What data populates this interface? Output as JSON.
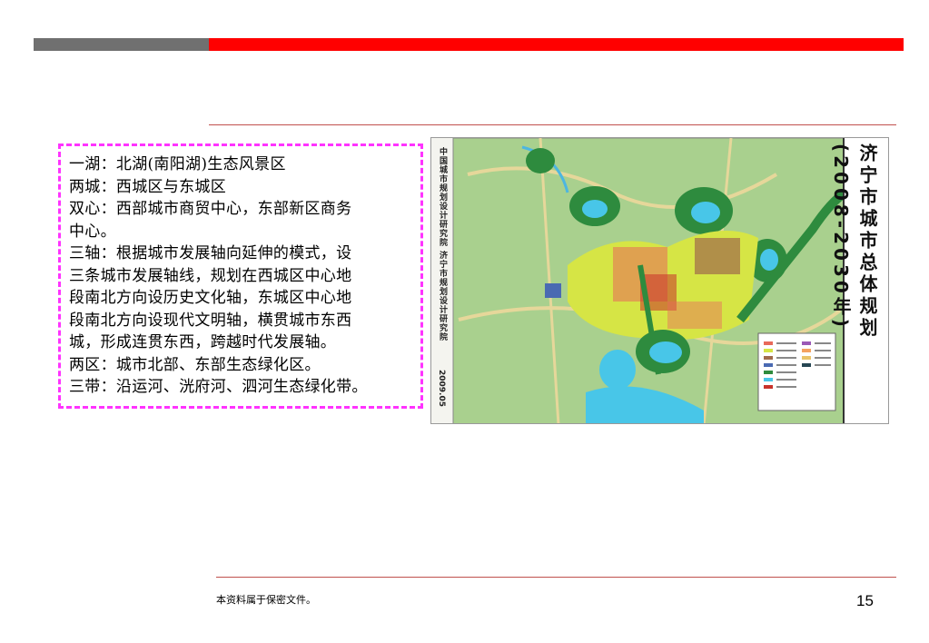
{
  "colors": {
    "accent": "#ff0000",
    "gray_bar": "#707070",
    "rule": "#c0504d",
    "dashed_border": "#ff33ff"
  },
  "content": {
    "lines": [
      "一湖：北湖(南阳湖)生态风景区",
      "两城：西城区与东城区",
      "双心：西部城市商贸中心，东部新区商务",
      "中心。",
      "三轴：根据城市发展轴向延伸的模式，设",
      "三条城市发展轴线，规划在西城区中心地",
      "段南北方向设历史文化轴，东城区中心地",
      "段南北方向设现代文明轴，横贯城市东西",
      "城，形成连贯东西，跨越时代发展轴。",
      "两区：城市北部、东部生态绿化区。",
      "三带：沿运河、洸府河、泗河生态绿化带。"
    ]
  },
  "map": {
    "title": "济宁市城市总体规划(2008-2030年)",
    "institute": "中国城市规划设计研究院 济宁市规划设计研究院",
    "date": "2009.05"
  },
  "footer": {
    "note": "本资料属于保密文件。",
    "page": "15"
  }
}
